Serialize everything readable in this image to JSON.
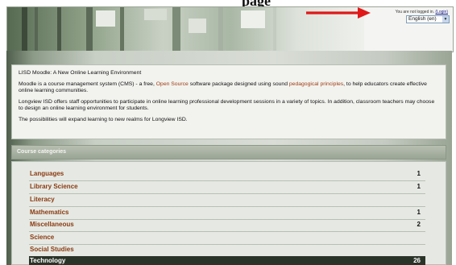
{
  "header": {
    "login_status": "You are not logged in.",
    "login_link": "(Login)",
    "language": "English (en)"
  },
  "intro": {
    "title": "LISD Moodle: A New Online Learning Environment",
    "p1_start": "Moodle is a course management system (CMS) - a free, ",
    "p1_link1": "Open Source",
    "p1_mid": " software package designed using sound ",
    "p1_link2": "pedagogical principles",
    "p1_end": ", to help educators create effective online learning communities.",
    "p2": "Longview ISD offers staff opportunities to participate in online learning professional development sessions in a variety of topics. In addition, classroom teachers may choose to design an online learning environment for students.",
    "p3": "The possibilities will expand learning to new realms for Longview ISD."
  },
  "categories": {
    "header": "Course categories",
    "items": [
      {
        "name": "Languages",
        "count": "1"
      },
      {
        "name": "Library Science",
        "count": "1"
      },
      {
        "name": "Literacy",
        "count": ""
      },
      {
        "name": "Mathematics",
        "count": "1"
      },
      {
        "name": "Miscellaneous",
        "count": "2"
      },
      {
        "name": "Science",
        "count": ""
      },
      {
        "name": "Social Studies",
        "count": ""
      },
      {
        "name": "Technology",
        "count": "26"
      }
    ]
  },
  "colors": {
    "annotation_arrow": "#e01818",
    "link": "#a03c14",
    "category_link": "#8a3a12"
  }
}
